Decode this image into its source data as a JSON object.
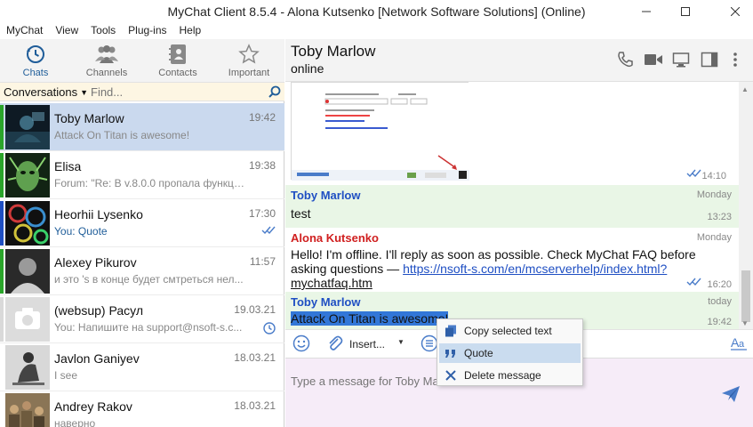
{
  "window": {
    "title": "MyChat Client 8.5.4 - Alona Kutsenko [Network Software Solutions] (Online)"
  },
  "menu": [
    "MyChat",
    "View",
    "Tools",
    "Plug-ins",
    "Help"
  ],
  "nav": {
    "tabs": [
      {
        "label": "Chats",
        "icon": "chats-clock-icon",
        "active": true
      },
      {
        "label": "Channels",
        "icon": "channels-people-icon",
        "active": false
      },
      {
        "label": "Contacts",
        "icon": "contacts-book-icon",
        "active": false
      },
      {
        "label": "Important",
        "icon": "star-icon",
        "active": false
      }
    ]
  },
  "conversations": {
    "selector_label": "Conversations",
    "search_placeholder": "Find...",
    "items": [
      {
        "name": "Toby Marlow",
        "time": "19:42",
        "preview": "Attack On Titan is awesome!",
        "stripe": "#2aa52a",
        "avatar": "dark-blue",
        "selected": true
      },
      {
        "name": "Elisa",
        "time": "19:38",
        "preview": "Forum: \"Re: В v.8.0.0 пропала функци...",
        "stripe": "#2aa52a",
        "avatar": "green-face"
      },
      {
        "name": "Heorhii Lysenko",
        "time": "17:30",
        "preview": "You: Quote",
        "stripe": "#1f4fc3",
        "avatar": "circles",
        "preview_blue": true,
        "status": "double-check-icon"
      },
      {
        "name": "Alexey Pikurov",
        "time": "11:57",
        "preview": "и это 's в конце будет смтреться нел...",
        "stripe": "#2aa52a",
        "avatar": "bw-man"
      },
      {
        "name": "(websup) Расул",
        "time": "19.03.21",
        "preview": "You: Напишите на support@nsoft-s.c...",
        "stripe": "#d9d9d9",
        "avatar": "camera",
        "status": "clock-icon"
      },
      {
        "name": "Javlon Ganiyev",
        "time": "18.03.21",
        "preview": "I see",
        "stripe": "#ffffff",
        "avatar": "sitting-man"
      },
      {
        "name": "Andrey Rakov",
        "time": "18.03.21",
        "preview": "наверно",
        "stripe": "#ffffff",
        "avatar": "crowd"
      }
    ]
  },
  "chat": {
    "contact_name": "Toby Marlow",
    "contact_status": "online",
    "image_message_time": "14:10",
    "messages": [
      {
        "author": "Toby Marlow",
        "author_color": "blue",
        "day": "Monday",
        "text": "test",
        "time": "13:23"
      },
      {
        "author": "Alona Kutsenko",
        "author_color": "red",
        "day": "Monday",
        "text_line1": "Hello! I'm offline. I'll reply as soon as possible. Check MyChat FAQ before",
        "text_line2_prefix": "asking questions — ",
        "link_part1": "https://nsoft-s.com/en/mcserverhelp/index.html?",
        "link_part2": "mychatfaq.htm",
        "time": "16:20"
      },
      {
        "author": "Toby Marlow",
        "author_color": "blue",
        "day": "today",
        "text": "Attack On Titan is awesome!",
        "time": "19:42"
      }
    ]
  },
  "toolbar": {
    "insert_label": "Insert..."
  },
  "composer": {
    "placeholder": "Type a message for Toby Marlow"
  },
  "context_menu": {
    "items": [
      {
        "label": "Copy selected text",
        "icon": "copy-icon"
      },
      {
        "label": "Quote",
        "icon": "quote-icon",
        "highlighted": true
      },
      {
        "label": "Delete message",
        "icon": "delete-x-icon"
      }
    ]
  },
  "colors": {
    "accent": "#1f5d99",
    "selected_row": "#cad9ee",
    "green_msg": "#e9f6e6",
    "composer_bg": "#f6ecf8",
    "author_blue": "#1f4fc3",
    "author_red": "#d02020"
  }
}
